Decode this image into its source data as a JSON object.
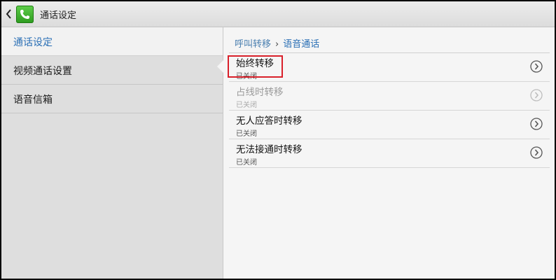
{
  "actionbar": {
    "title": "通话设定"
  },
  "sidebar": {
    "items": [
      {
        "label": "通话设定"
      },
      {
        "label": "视频通话设置"
      },
      {
        "label": "语音信箱"
      }
    ]
  },
  "breadcrumb": {
    "parent": "呼叫转移",
    "separator": "›",
    "current": "语音通话"
  },
  "rows": [
    {
      "title": "始终转移",
      "status": "已关闭",
      "enabled": true,
      "highlighted": true
    },
    {
      "title": "占线时转移",
      "status": "已关闭",
      "enabled": false
    },
    {
      "title": "无人应答时转移",
      "status": "已关闭",
      "enabled": true
    },
    {
      "title": "无法接通时转移",
      "status": "已关闭",
      "enabled": true
    }
  ],
  "icons": {
    "back": "back-chevron-icon",
    "app": "phone-icon",
    "row": "circle-chevron-right-icon"
  },
  "colors": {
    "accent": "#2a6fb5",
    "highlight": "#d9202a",
    "app_green": "#3bb02a"
  }
}
